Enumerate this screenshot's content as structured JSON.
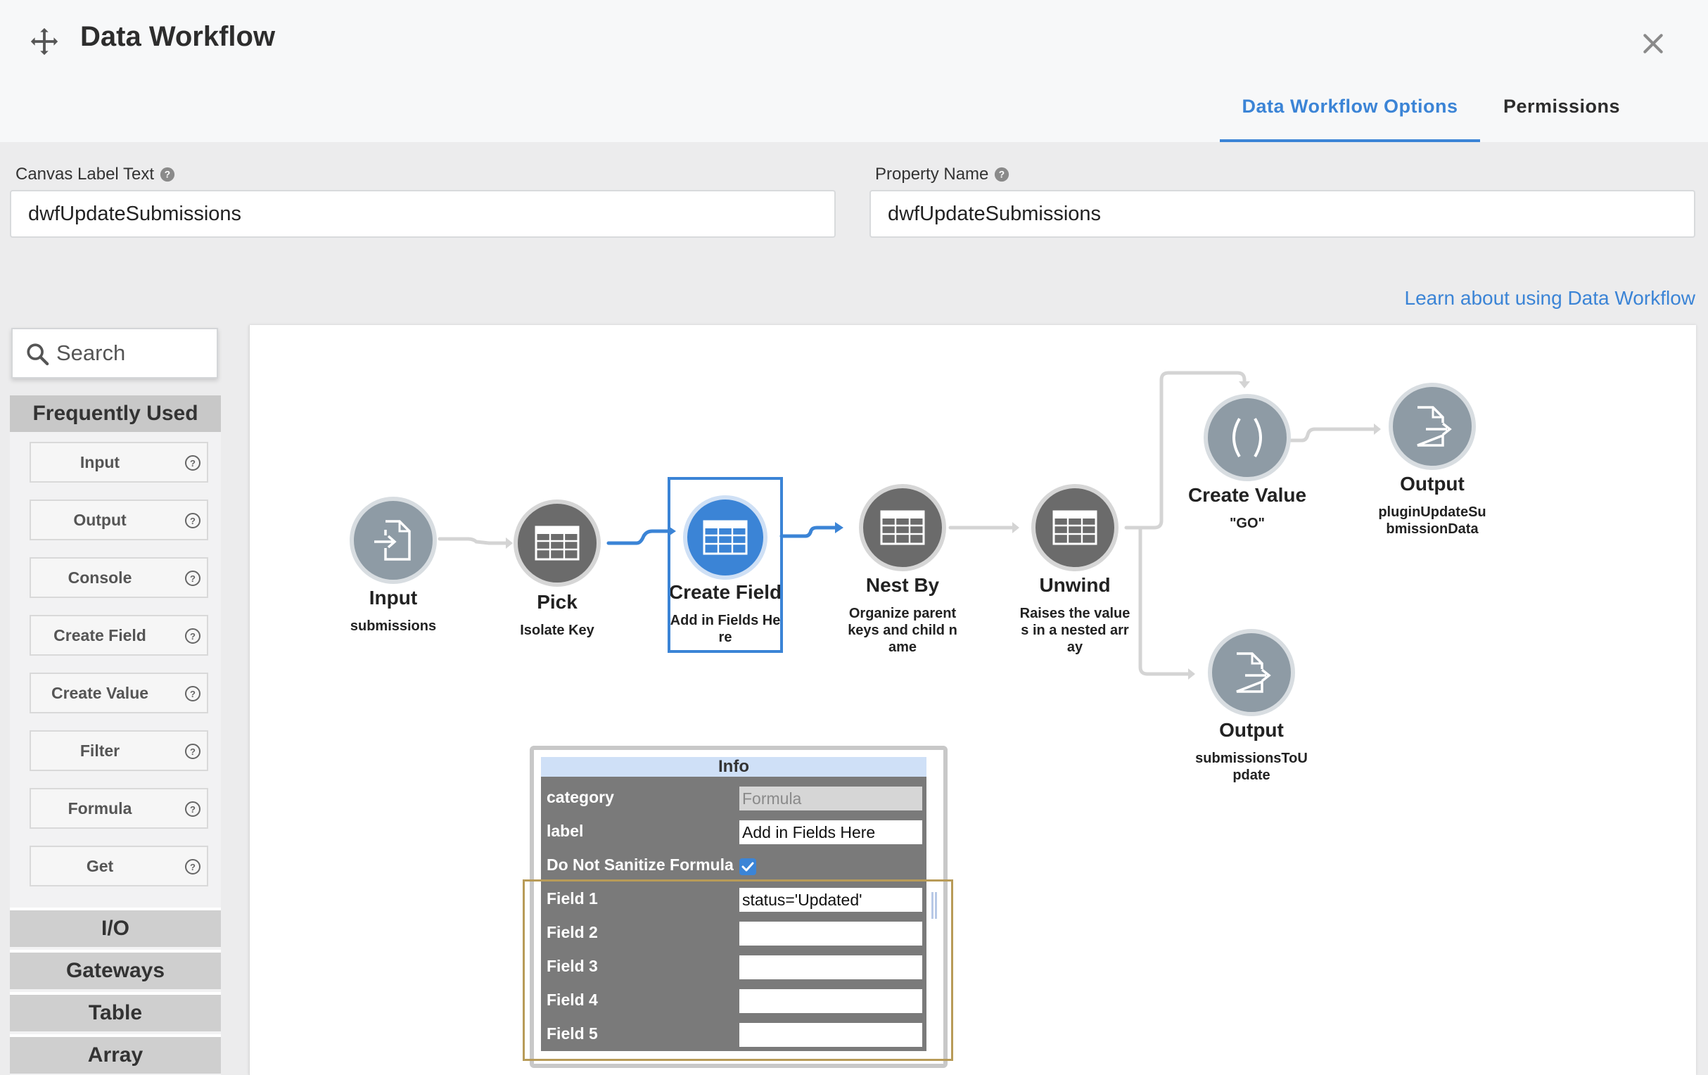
{
  "header": {
    "title": "Data Workflow",
    "tabs": [
      {
        "label": "Data Workflow Options",
        "active": true
      },
      {
        "label": "Permissions",
        "active": false
      }
    ]
  },
  "form": {
    "canvas_label": {
      "label": "Canvas Label Text",
      "value": "dwfUpdateSubmissions"
    },
    "property_name": {
      "label": "Property Name",
      "value": "dwfUpdateSubmissions"
    },
    "learn_link": "Learn about using Data Workflow"
  },
  "palette": {
    "search_placeholder": "Search",
    "frequently_used_label": "Frequently Used",
    "items": [
      "Input",
      "Output",
      "Console",
      "Create Field",
      "Create Value",
      "Filter",
      "Formula",
      "Get"
    ],
    "categories": [
      "I/O",
      "Gateways",
      "Table",
      "Array"
    ]
  },
  "nodes": {
    "input": {
      "title": "Input",
      "sub": "submissions",
      "icon": "file-import-icon"
    },
    "pick": {
      "title": "Pick",
      "sub": "Isolate Key",
      "icon": "table-icon"
    },
    "create_field": {
      "title": "Create Field",
      "sub": "Add in Fields Here",
      "icon": "table-icon"
    },
    "nest_by": {
      "title": "Nest By",
      "sub": "Organize parent keys and child name",
      "icon": "table-icon"
    },
    "unwind": {
      "title": "Unwind",
      "sub": "Raises the values in a nested array",
      "icon": "table-icon"
    },
    "create_value": {
      "title": "Create Value",
      "sub": "\"GO\"",
      "icon": "parentheses-icon"
    },
    "output_plugin": {
      "title": "Output",
      "sub": "pluginUpdateSubmissionData",
      "icon": "file-export-icon"
    },
    "output_submissions": {
      "title": "Output",
      "sub": "submissionsToUpdate",
      "icon": "file-export-icon"
    }
  },
  "info": {
    "header": "Info",
    "rows": [
      {
        "key": "category",
        "value": "Formula"
      },
      {
        "key": "label",
        "value": "Add in Fields Here"
      },
      {
        "key": "Do Not Sanitize Formula",
        "checked": true
      },
      {
        "key": "Field 1",
        "value": "status='Updated'"
      },
      {
        "key": "Field 2",
        "value": ""
      },
      {
        "key": "Field 3",
        "value": ""
      },
      {
        "key": "Field 4",
        "value": ""
      },
      {
        "key": "Field 5",
        "value": ""
      }
    ]
  },
  "colors": {
    "accent": "#3b84d6",
    "node_dark": "#6b6b6b",
    "node_light": "#8e9ba5",
    "highlight": "#b89b58"
  }
}
